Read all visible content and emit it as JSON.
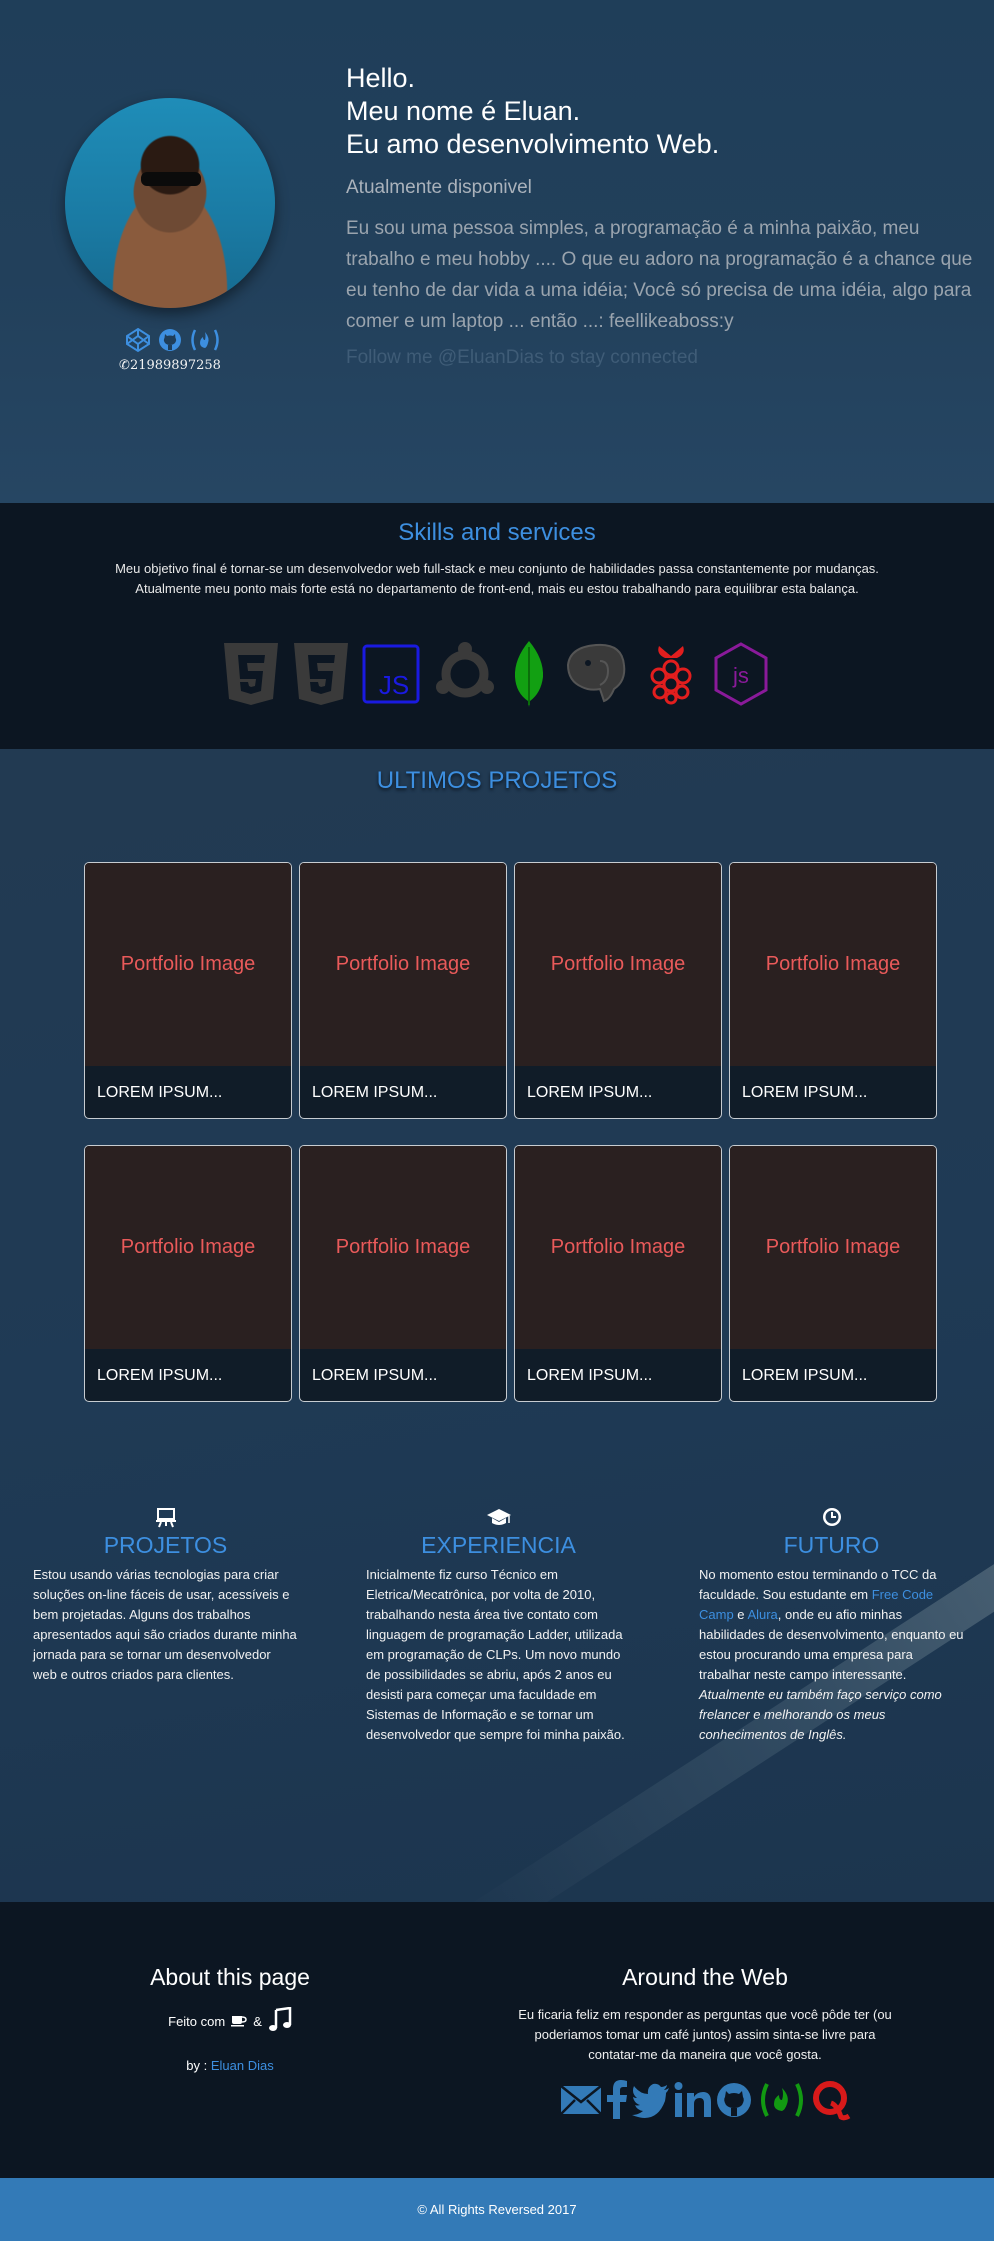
{
  "hero": {
    "greeting_line1": "Hello.",
    "greeting_line2": "Meu nome é Eluan.",
    "greeting_line3": "Eu amo desenvolvimento Web.",
    "status": "Atualmente disponivel",
    "bio": "Eu sou uma pessoa simples, a programação é a minha paixão, meu trabalho e meu hobby .... O que eu adoro na programação é a chance que eu tenho de dar vida a uma idéia; Você só precisa de uma idéia, algo para comer e um laptop ... então ...: feellikeaboss:y",
    "follow": "Follow me @EluanDias to stay connected",
    "phone": "21989897258",
    "profile_icons": [
      "codepen-icon",
      "github-icon",
      "freecodecamp-icon"
    ]
  },
  "skills": {
    "title": "Skills and services",
    "description": "Meu objetivo final é tornar-se um desenvolvedor web full-stack e meu conjunto de habilidades passa constantemente por mudanças. Atualmente meu ponto mais forte está no departamento de front-end, mais eu estou trabalhando para equilibrar esta balança.",
    "tech_icons": [
      "html5-icon",
      "css3-icon",
      "javascript-icon",
      "ubuntu-icon",
      "mongodb-icon",
      "postgresql-icon",
      "raspberry-pi-icon",
      "nodejs-icon"
    ],
    "js_label": "JS",
    "node_label": "js"
  },
  "projects": {
    "title": "ULTIMOS PROJETOS",
    "cards": [
      {
        "image_label": "Portfolio Image",
        "caption": "LOREM IPSUM..."
      },
      {
        "image_label": "Portfolio Image",
        "caption": "LOREM IPSUM..."
      },
      {
        "image_label": "Portfolio Image",
        "caption": "LOREM IPSUM..."
      },
      {
        "image_label": "Portfolio Image",
        "caption": "LOREM IPSUM..."
      },
      {
        "image_label": "Portfolio Image",
        "caption": "LOREM IPSUM..."
      },
      {
        "image_label": "Portfolio Image",
        "caption": "LOREM IPSUM..."
      },
      {
        "image_label": "Portfolio Image",
        "caption": "LOREM IPSUM..."
      },
      {
        "image_label": "Portfolio Image",
        "caption": "LOREM IPSUM..."
      }
    ]
  },
  "about_columns": {
    "projetos": {
      "icon": "presentation-icon",
      "title": "PROJETOS",
      "text": "Estou usando várias tecnologias para criar soluções on-line fáceis de usar, acessíveis e bem projetadas. Alguns dos trabalhos apresentados aqui são criados durante minha jornada para se tornar um desenvolvedor web e outros criados para clientes."
    },
    "experiencia": {
      "icon": "graduation-cap-icon",
      "title": "EXPERIENCIA",
      "text": "Inicialmente fiz curso Técnico em Eletrica/Mecatrônica, por volta de 2010, trabalhando nesta área tive contato com linguagem de programação Ladder, utilizada em programação de CLPs. Um novo mundo de possibilidades se abriu, após 2 anos eu desisti para começar uma faculdade em Sistemas de Informação e se tornar um desenvolvedor que sempre foi minha paixão."
    },
    "futuro": {
      "icon": "clock-icon",
      "title": "FUTURO",
      "text_before": "No momento estou terminando o TCC da faculdade. Sou estudante em ",
      "link1": "Free Code Camp",
      "text_middle": " e ",
      "link2": "Alura",
      "text_after": ", onde eu afio minhas habilidades de desenvolvimento, enquanto eu estou procurando uma empresa para trabalhar neste campo interessante.",
      "italic": "Atualmente eu também faço serviço como frelancer e melhorando os meus conhecimentos de Inglês."
    }
  },
  "footer": {
    "about_title": "About this page",
    "made_with": "Feito com",
    "and": "&",
    "by_label": "by :",
    "by_name": "Eluan Dias",
    "around_title": "Around the Web",
    "around_text": "Eu ficaria feliz em responder as perguntas que você pôde ter (ou poderiamos tomar um café juntos) assim sinta-se livre para contatar-me da maneira que você gosta.",
    "social_icons": [
      "email-icon",
      "facebook-icon",
      "twitter-icon",
      "linkedin-icon",
      "github-icon",
      "freecodecamp-icon",
      "quora-icon"
    ],
    "copyright": "© All Rights Reversed 2017"
  },
  "colors": {
    "accent": "#3d8fe0",
    "card_image_text": "#e95a5a",
    "bottom_bar": "#337ab7",
    "dark_band": "#0c1622"
  }
}
